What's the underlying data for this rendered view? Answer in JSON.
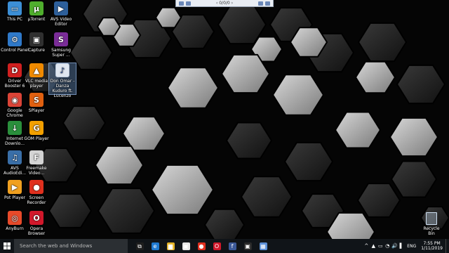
{
  "desktop_icons": [
    {
      "name": "this-pc",
      "label": "This PC",
      "color": "#3c8fd6",
      "glyph": "▭"
    },
    {
      "name": "utorrent",
      "label": "µTorrent",
      "color": "#4fae2d",
      "glyph": "µ"
    },
    {
      "name": "avs-video-editor",
      "label": "AVS Video Editor",
      "color": "#2d5f9a",
      "glyph": "▶"
    },
    {
      "name": "control-panel",
      "label": "Control Panel",
      "color": "#2f79c9",
      "glyph": "⚙"
    },
    {
      "name": "capture",
      "label": "Capture",
      "color": "#303030",
      "glyph": "▣"
    },
    {
      "name": "samsung",
      "label": "Samsung Super ...",
      "color": "#7a2c98",
      "glyph": "S"
    },
    {
      "name": "driver-booster",
      "label": "Driver Booster 6",
      "color": "#d02020",
      "glyph": "D"
    },
    {
      "name": "vlc",
      "label": "VLC media player",
      "color": "#f08a00",
      "glyph": "▲"
    },
    {
      "name": "don-omar-file",
      "label": "Don Omar - Danza Kuduro ft. Lucenzo",
      "color": "#dfe6f0",
      "glyph": "♪"
    },
    {
      "name": "google-chrome",
      "label": "Google Chrome",
      "color": "#db4437",
      "glyph": "◉"
    },
    {
      "name": "splayer",
      "label": "SPlayer",
      "color": "#e06010",
      "glyph": "S"
    },
    {
      "name": "internet-download-manager",
      "label": "Internet Downlo...",
      "color": "#2a8f3c",
      "glyph": "↓"
    },
    {
      "name": "gom-player",
      "label": "GOM Player",
      "color": "#f2a000",
      "glyph": "G"
    },
    {
      "name": "avs-audio",
      "label": "AVS AudioEdi...",
      "color": "#3a6fa8",
      "glyph": "♫"
    },
    {
      "name": "freemake",
      "label": "Freemake Video...",
      "color": "#d4d4d4",
      "glyph": "F"
    },
    {
      "name": "pot-player",
      "label": "Pot Player",
      "color": "#f0a020",
      "glyph": "▶"
    },
    {
      "name": "screen-recorder",
      "label": "Screen Recorder",
      "color": "#e0301e",
      "glyph": "●"
    },
    {
      "name": "anyburn",
      "label": "AnyBurn",
      "color": "#e84a2a",
      "glyph": "◎"
    },
    {
      "name": "opera",
      "label": "Opera Browser",
      "color": "#d1182b",
      "glyph": "O"
    }
  ],
  "capture_toolbar": {
    "label": "‹ 0/0/0 ›"
  },
  "taskbar": {
    "search_placeholder": "Search the web and Windows",
    "apps": [
      {
        "name": "task-view",
        "color": "#1e1e1e",
        "glyph": "⧉"
      },
      {
        "name": "edge",
        "color": "#1f7ad1",
        "glyph": "e"
      },
      {
        "name": "file-explorer",
        "color": "#e5b428",
        "glyph": "▆"
      },
      {
        "name": "store",
        "color": "#e8e8e8",
        "glyph": "▣"
      },
      {
        "name": "media-player",
        "color": "#e03020",
        "glyph": "●"
      },
      {
        "name": "opera",
        "color": "#d1182b",
        "glyph": "O"
      },
      {
        "name": "facebook",
        "color": "#3b5998",
        "glyph": "f"
      },
      {
        "name": "capture-app",
        "color": "#2a2a2a",
        "glyph": "▣"
      },
      {
        "name": "photos",
        "color": "#5b8fd6",
        "glyph": "▦"
      }
    ],
    "tray": {
      "icons": [
        "^",
        "▲",
        "▭",
        "◔",
        "🔊",
        "▌"
      ],
      "lang": "ENG",
      "time": "7:55 PM",
      "date": "1/11/2019"
    }
  },
  "recycle_bin": {
    "label": "Recycle Bin"
  }
}
